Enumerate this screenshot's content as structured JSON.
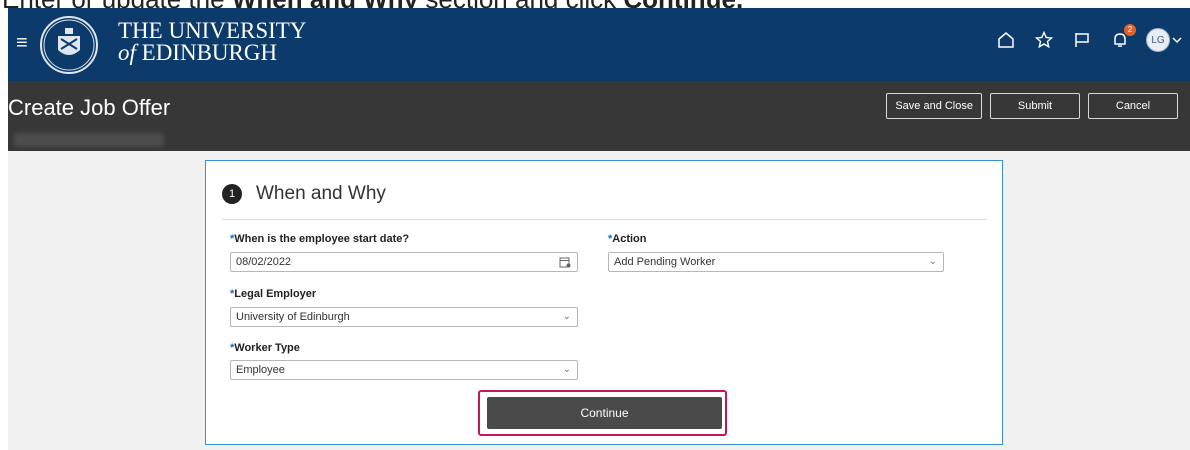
{
  "instruction": {
    "prefix": "Enter or update the ",
    "bold_section": "When and Why",
    "middle": " section and click ",
    "bold_button": "Continue.",
    "color": "#222222"
  },
  "header": {
    "university_line1": "THE UNIVERSITY",
    "university_line2_prefix": "of",
    "university_line2": " EDINBURGH",
    "crest_text": "THE UNIVERSITY OF EDINBURGH",
    "bg_color": "#0c3a6a",
    "icons": [
      "home-icon",
      "star-icon",
      "flag-icon",
      "notifications-icon",
      "avatar"
    ],
    "notification_count": "2",
    "avatar_initials": "LG"
  },
  "page_header": {
    "title": "Create Job Offer",
    "buttons": {
      "save_close": "Save and Close",
      "submit": "Submit",
      "cancel": "Cancel"
    },
    "bg_color": "#373737"
  },
  "step": {
    "number": "1",
    "title": "When and Why"
  },
  "form": {
    "start_date": {
      "required": "*",
      "label": "When is the employee start date?",
      "value": "08/02/2022"
    },
    "action": {
      "required": "*",
      "label": "Action",
      "value": "Add Pending Worker"
    },
    "legal_employer": {
      "required": "*",
      "label": "Legal Employer",
      "value": "University of Edinburgh"
    },
    "worker_type": {
      "required": "*",
      "label": "Worker Type",
      "value": "Employee"
    }
  },
  "continue_button": {
    "label": "Continue"
  },
  "colors": {
    "accent_border": "#3b8ed6",
    "highlight": "#c2185b",
    "required": "#0a6ec4"
  }
}
